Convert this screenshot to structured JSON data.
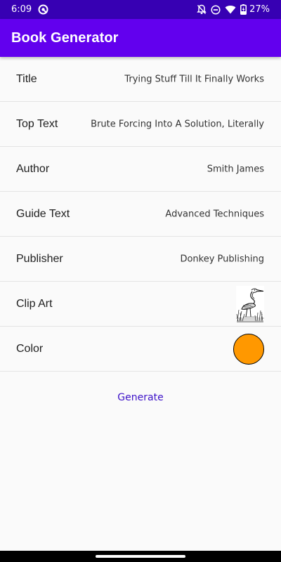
{
  "status_bar": {
    "time": "6:09",
    "battery_percent": "27%",
    "left_icons": [
      "vpn-key-icon"
    ],
    "right_icons": [
      "notifications-off-icon",
      "do-not-disturb-icon",
      "wifi-icon",
      "battery-charging-icon"
    ]
  },
  "app_bar": {
    "title": "Book Generator",
    "color": "#6200ee",
    "status_color": "#3700b3"
  },
  "fields": {
    "title": {
      "label": "Title",
      "value": "Trying Stuff Till It Finally Works"
    },
    "top_text": {
      "label": "Top Text",
      "value": "Brute Forcing Into A Solution, Literally"
    },
    "author": {
      "label": "Author",
      "value": "Smith James"
    },
    "guide_text": {
      "label": "Guide Text",
      "value": "Advanced Techniques"
    },
    "publisher": {
      "label": "Publisher",
      "value": "Donkey Publishing"
    },
    "clip_art": {
      "label": "Clip Art",
      "image": "heron-sketch-image"
    },
    "color": {
      "label": "Color",
      "value": "#ff9800"
    }
  },
  "actions": {
    "generate_label": "Generate",
    "generate_color": "#3d12c8"
  }
}
